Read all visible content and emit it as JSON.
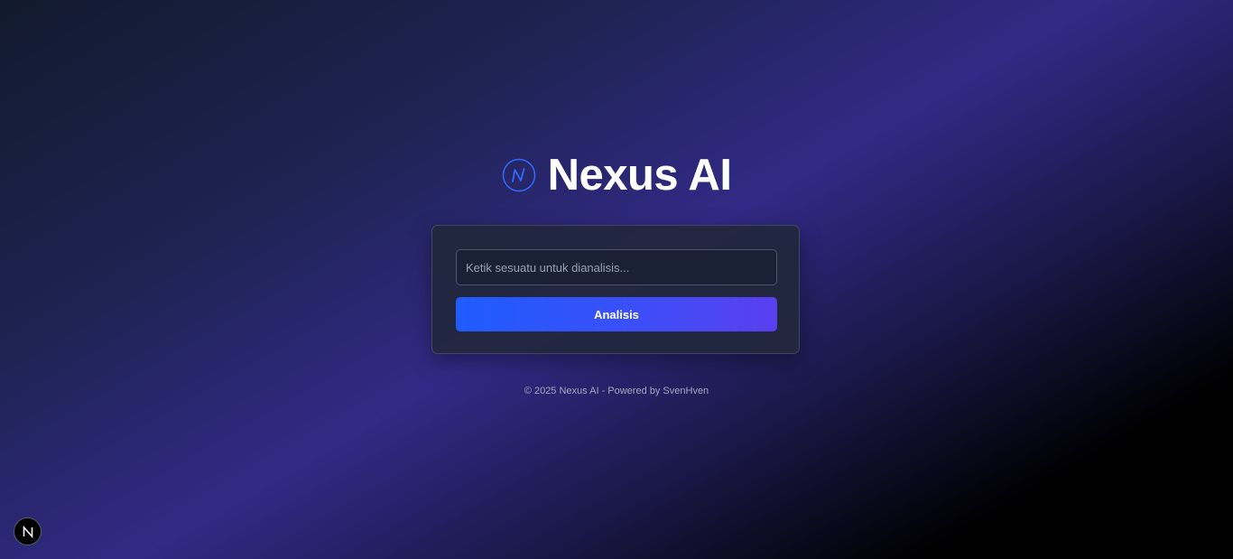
{
  "brand": {
    "title": "Nexus AI",
    "logo_icon": "nexus-n-circle-icon",
    "logo_color": "#2f6bff"
  },
  "form": {
    "input_placeholder": "Ketik sesuatu untuk dianalisis...",
    "input_value": "",
    "submit_label": "Analisis"
  },
  "footer": {
    "text": "© 2025 Nexus AI - Powered by SvenHven"
  },
  "dev_badge": {
    "icon": "nextjs-n-icon"
  },
  "colors": {
    "accent_start": "#1f5cff",
    "accent_end": "#5a3ff0",
    "card_bg": "#22283e",
    "input_bg": "#1a2035"
  }
}
